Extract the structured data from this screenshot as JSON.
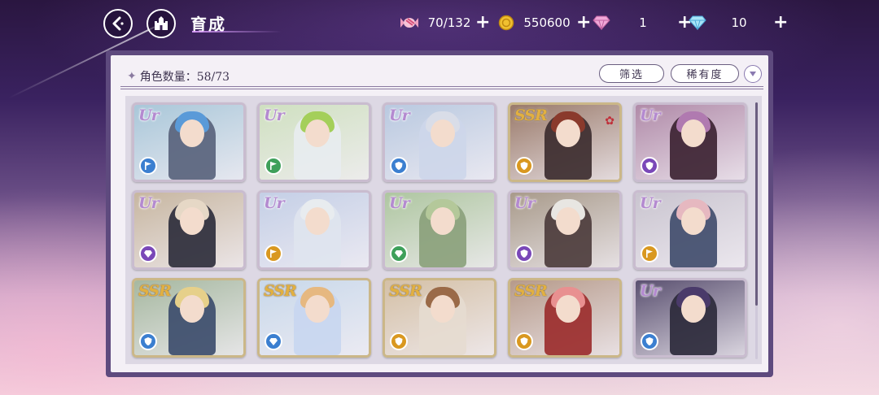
{
  "header": {
    "title": "育成"
  },
  "resources": {
    "candy": {
      "value": "70/132",
      "icon": "candy-icon"
    },
    "gold": {
      "value": "550600",
      "icon": "gold-coin-icon"
    },
    "pink_gem": {
      "value": "1",
      "icon": "pink-gem-icon"
    },
    "blue_gem": {
      "value": "10",
      "icon": "blue-gem-icon"
    }
  },
  "panel": {
    "count_label": "角色数量：58/73",
    "filter_label": "筛选",
    "rarity_label": "稀有度"
  },
  "colors": {
    "panel_frame": "#5e4a7e",
    "panel_bg": "#f4f0f6",
    "ur": "#b48ad0",
    "ssr": "#e2b040",
    "attr_blue": "#3b7fd0",
    "attr_green": "#3ea05a",
    "attr_purple": "#7a48b8",
    "attr_orange": "#d99820"
  },
  "characters": [
    {
      "rarity": "UR",
      "attribute": "blue",
      "attr_icon": "flag-icon",
      "hair": "#5a9ad8",
      "outfit": "#56607a",
      "bg": "#a9c7d9"
    },
    {
      "rarity": "UR",
      "attribute": "green",
      "attr_icon": "flag-icon",
      "hair": "#a4cf5a",
      "outfit": "#e8ecef",
      "bg": "#cfe0c0"
    },
    {
      "rarity": "UR",
      "attribute": "blue",
      "attr_icon": "shield-icon",
      "hair": "#d9dde8",
      "outfit": "#cdd6ea",
      "bg": "#b9c9e0"
    },
    {
      "rarity": "SSR",
      "attribute": "orange",
      "attr_icon": "shield-icon",
      "hair": "#8a3a2c",
      "outfit": "#3a2a2c",
      "bg": "#9a7a6a",
      "fav": true
    },
    {
      "rarity": "UR",
      "attribute": "purple",
      "attr_icon": "shield-icon",
      "hair": "#b07ab0",
      "outfit": "#3a2030",
      "bg": "#b08aa8"
    },
    {
      "rarity": "UR",
      "attribute": "purple",
      "attr_icon": "gem-icon",
      "hair": "#e6d8c6",
      "outfit": "#2a2a38",
      "bg": "#c7b6a0"
    },
    {
      "rarity": "UR",
      "attribute": "orange",
      "attr_icon": "flag-icon",
      "hair": "#e8ecef",
      "outfit": "#dfe4ee",
      "bg": "#c4cfe6"
    },
    {
      "rarity": "UR",
      "attribute": "green",
      "attr_icon": "gem-icon",
      "hair": "#b4c89a",
      "outfit": "#8aa07a",
      "bg": "#aec6a0"
    },
    {
      "rarity": "UR",
      "attribute": "purple",
      "attr_icon": "shield-icon",
      "hair": "#e8e6e2",
      "outfit": "#4a3a3a",
      "bg": "#a89a8a"
    },
    {
      "rarity": "UR",
      "attribute": "orange",
      "attr_icon": "flag-icon",
      "hair": "#e6b8c0",
      "outfit": "#3e4a6a",
      "bg": "#c9c4cf"
    },
    {
      "rarity": "SSR",
      "attribute": "blue",
      "attr_icon": "shield-icon",
      "hair": "#e6d08a",
      "outfit": "#3a4a6a",
      "bg": "#a6b8a0"
    },
    {
      "rarity": "SSR",
      "attribute": "blue",
      "attr_icon": "gem-icon",
      "hair": "#e6b880",
      "outfit": "#c8d6ef",
      "bg": "#c8d8ea"
    },
    {
      "rarity": "SSR",
      "attribute": "orange",
      "attr_icon": "shield-icon",
      "hair": "#9a6a48",
      "outfit": "#e6dcd0",
      "bg": "#d4c0a6"
    },
    {
      "rarity": "SSR",
      "attribute": "orange",
      "attr_icon": "shield-icon",
      "hair": "#e89090",
      "outfit": "#9a2a2a",
      "bg": "#b69a8a"
    },
    {
      "rarity": "UR",
      "attribute": "blue",
      "attr_icon": "shield-icon",
      "hair": "#4a3a6a",
      "outfit": "#2a2838",
      "bg": "#5a5070"
    }
  ]
}
